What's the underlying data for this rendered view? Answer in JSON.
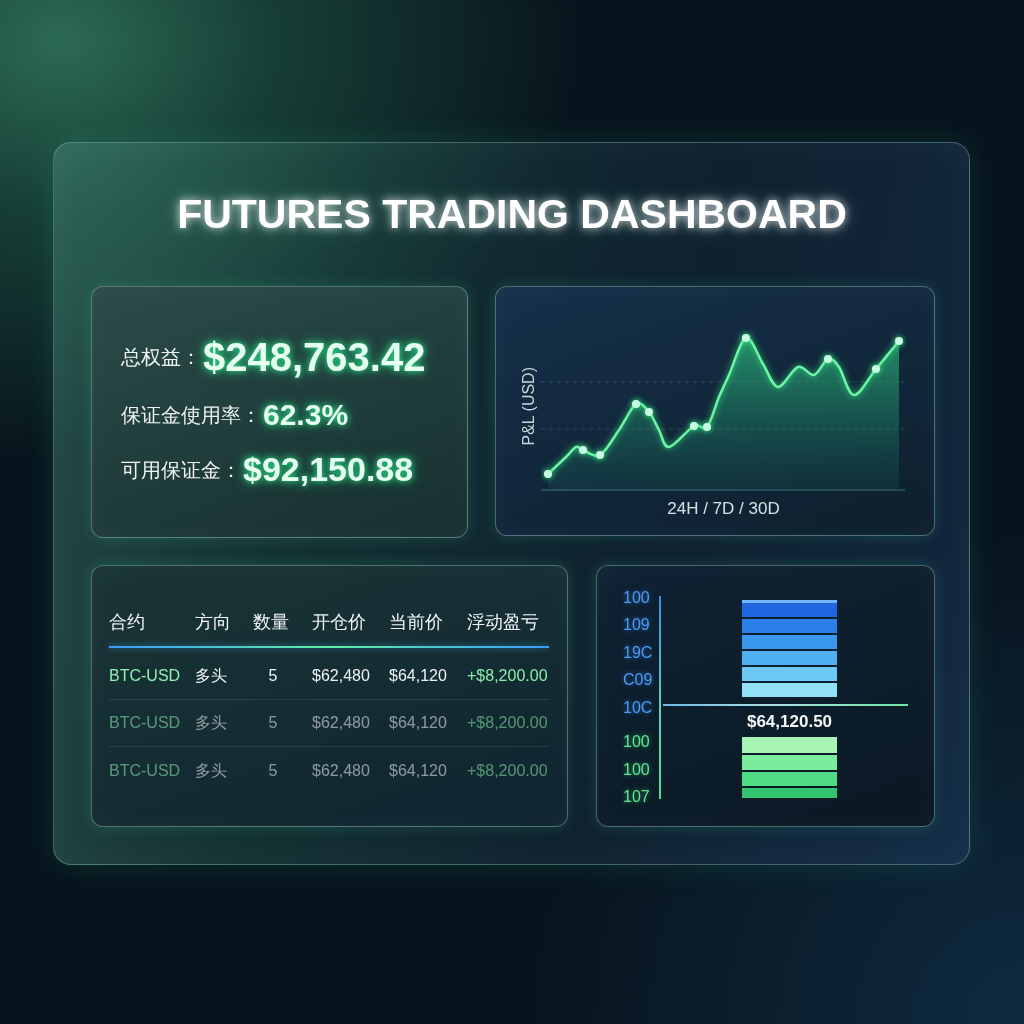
{
  "title": "FUTURES TRADING DASHBOARD",
  "account_summary": [
    {
      "label": "总权益：",
      "value": "$248,763.42"
    },
    {
      "label": "保证金使用率：",
      "value": "62.3%"
    },
    {
      "label": "可用保证金：",
      "value": "$92,150.88"
    }
  ],
  "pnl_chart": {
    "ylabel": "P&L (USD)",
    "xlabel": "24H / 7D / 30D"
  },
  "positions": {
    "columns": [
      {
        "label": "合约",
        "kind": "symbol"
      },
      {
        "label": "方向",
        "kind": "side"
      },
      {
        "label": "数量",
        "kind": "qty"
      },
      {
        "label": "开仓价",
        "kind": "price"
      },
      {
        "label": "当前价",
        "kind": "price"
      },
      {
        "label": "浮动盈亏",
        "kind": "pnl"
      }
    ],
    "rows": [
      {
        "dimmed": false,
        "cells": [
          "BTC-USD",
          "多头",
          "5",
          "$62,480",
          "$64,120",
          "+$8,200.00"
        ]
      },
      {
        "dimmed": true,
        "cells": [
          "BTC-USD",
          "多头",
          "5",
          "$62,480",
          "$64,120",
          "+$8,200.00"
        ]
      },
      {
        "dimmed": true,
        "cells": [
          "BTC-USD",
          "多头",
          "5",
          "$62,480",
          "$64,120",
          "+$8,200.00"
        ]
      }
    ]
  },
  "order_book": {
    "ticks": [
      {
        "text": "100",
        "kind": "ask"
      },
      {
        "text": "109",
        "kind": "ask"
      },
      {
        "text": "19C",
        "kind": "ask"
      },
      {
        "text": "C09",
        "kind": "ask"
      },
      {
        "text": "10C",
        "kind": "ask"
      },
      {
        "text": "100",
        "kind": "bid"
      },
      {
        "text": "100",
        "kind": "bid"
      },
      {
        "text": "107",
        "kind": "bid"
      }
    ],
    "mid_price": "$64,120.50"
  }
}
